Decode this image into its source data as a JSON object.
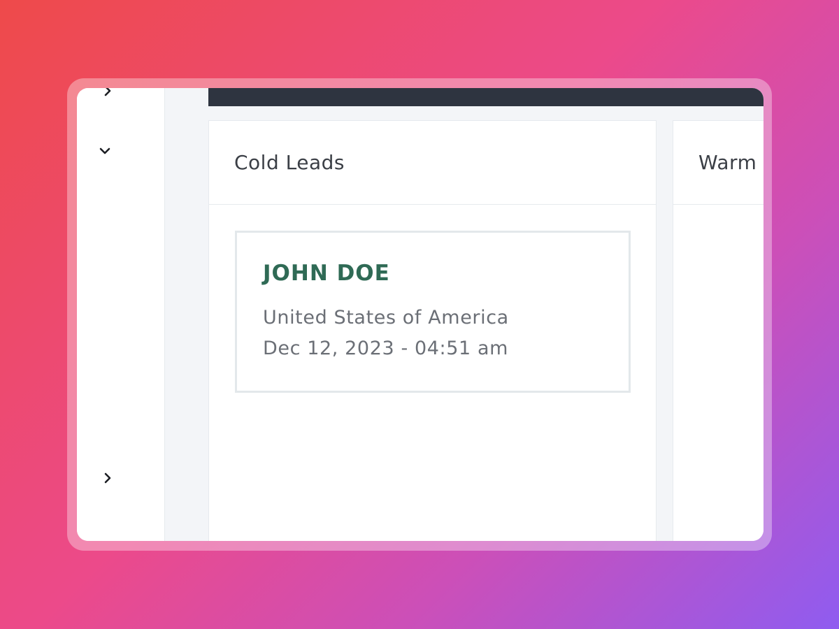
{
  "sidebar": {
    "icons": [
      "chevron-right-icon",
      "chevron-down-icon",
      "chevron-right-icon"
    ]
  },
  "board": {
    "columns": [
      {
        "title": "Cold Leads",
        "cards": [
          {
            "name": "JOHN DOE",
            "country": "United States of America",
            "date": "Dec 12, 2023 - 04:51 am"
          }
        ]
      },
      {
        "title": "Warm"
      }
    ]
  },
  "colors": {
    "topbar": "#2e3440",
    "lead_name": "#2f6a55",
    "background_gradient": [
      "#ee4a4a",
      "#ec4a8a",
      "#8f5cf0"
    ]
  }
}
